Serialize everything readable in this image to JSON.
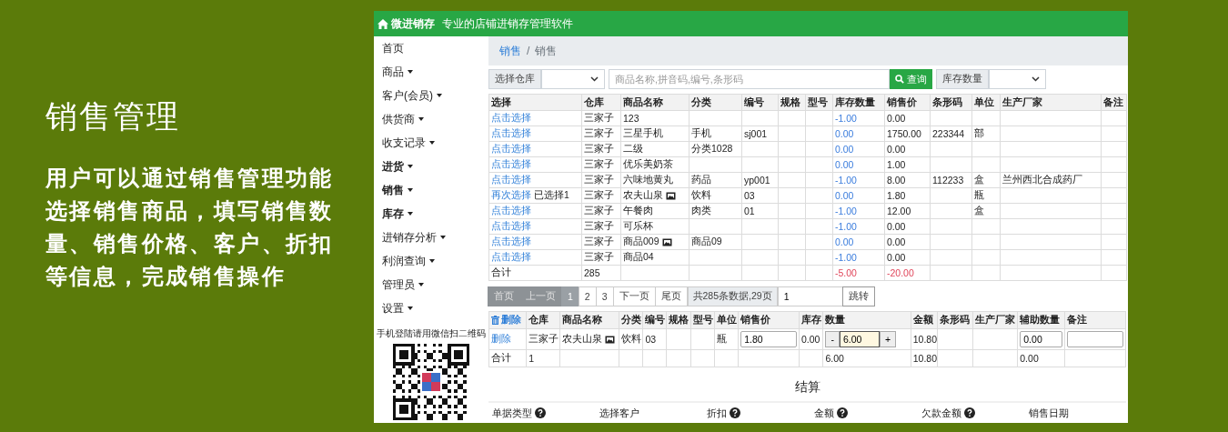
{
  "intro": {
    "title": "销售管理",
    "description": "用户可以通过销售管理功能选择销售商品，填写销售数量、销售价格、客户、折扣等信息，完成销售操作"
  },
  "header": {
    "brand": "微进销存",
    "tagline": "专业的店铺进销存管理软件"
  },
  "sidebar": {
    "items": [
      {
        "label": "首页",
        "dropdown": false,
        "bold": false
      },
      {
        "label": "商品",
        "dropdown": true,
        "bold": false
      },
      {
        "label": "客户(会员)",
        "dropdown": true,
        "bold": false
      },
      {
        "label": "供货商",
        "dropdown": true,
        "bold": false
      },
      {
        "label": "收支记录",
        "dropdown": true,
        "bold": false
      },
      {
        "label": "进货",
        "dropdown": true,
        "bold": true
      },
      {
        "label": "销售",
        "dropdown": true,
        "bold": true
      },
      {
        "label": "库存",
        "dropdown": true,
        "bold": true
      },
      {
        "label": "进销存分析",
        "dropdown": true,
        "bold": false
      },
      {
        "label": "利润查询",
        "dropdown": true,
        "bold": false
      },
      {
        "label": "管理员",
        "dropdown": true,
        "bold": false
      },
      {
        "label": "设置",
        "dropdown": true,
        "bold": false
      }
    ],
    "qr_caption": "手机登陆请用微信扫二维码"
  },
  "breadcrumb": {
    "items": [
      {
        "label": "销售",
        "link": true
      },
      {
        "label": "销售",
        "link": false
      }
    ],
    "separator": "/"
  },
  "search": {
    "warehouse_label": "选择仓库",
    "placeholder": "商品名称,拼音码,编号,条形码",
    "button": "查询",
    "stock_label": "库存数量"
  },
  "products": {
    "columns": [
      "选择",
      "仓库",
      "商品名称",
      "分类",
      "编号",
      "规格",
      "型号",
      "库存数量",
      "销售价",
      "条形码",
      "单位",
      "生产厂家",
      "备注"
    ],
    "rows": [
      {
        "kind": "item",
        "action": "点击选择",
        "warehouse": "三家子",
        "name": "123",
        "has_image": false,
        "category": "",
        "code": "",
        "stock": "-1.00",
        "price": "0.00",
        "barcode": "",
        "unit": "",
        "maker": ""
      },
      {
        "kind": "item",
        "action": "点击选择",
        "warehouse": "三家子",
        "name": "三星手机",
        "has_image": false,
        "category": "手机",
        "code": "sj001",
        "stock": "0.00",
        "price": "1750.00",
        "barcode": "223344",
        "unit": "部",
        "maker": ""
      },
      {
        "kind": "item",
        "action": "点击选择",
        "warehouse": "三家子",
        "name": "二级",
        "has_image": false,
        "category": "分类1028",
        "code": "",
        "stock": "0.00",
        "price": "0.00",
        "barcode": "",
        "unit": "",
        "maker": ""
      },
      {
        "kind": "item",
        "action": "点击选择",
        "warehouse": "三家子",
        "name": "优乐美奶茶",
        "has_image": false,
        "category": "",
        "code": "",
        "stock": "0.00",
        "price": "1.00",
        "barcode": "",
        "unit": "",
        "maker": ""
      },
      {
        "kind": "item",
        "action": "点击选择",
        "warehouse": "三家子",
        "name": "六味地黄丸",
        "has_image": false,
        "category": "药品",
        "code": "yp001",
        "stock": "-1.00",
        "price": "8.00",
        "barcode": "112233",
        "unit": "盒",
        "maker": "兰州西北合成药厂"
      },
      {
        "kind": "item",
        "action": "再次选择",
        "selected_note": "已选择1",
        "warehouse": "三家子",
        "name": "农夫山泉",
        "has_image": true,
        "category": "饮料",
        "code": "03",
        "stock": "0.00",
        "price": "1.80",
        "barcode": "",
        "unit": "瓶",
        "maker": ""
      },
      {
        "kind": "item",
        "action": "点击选择",
        "warehouse": "三家子",
        "name": "午餐肉",
        "has_image": false,
        "category": "肉类",
        "code": "01",
        "stock": "-1.00",
        "price": "12.00",
        "barcode": "",
        "unit": "盒",
        "maker": ""
      },
      {
        "kind": "item",
        "action": "点击选择",
        "warehouse": "三家子",
        "name": "可乐杯",
        "has_image": false,
        "category": "",
        "code": "",
        "stock": "-1.00",
        "price": "0.00",
        "barcode": "",
        "unit": "",
        "maker": ""
      },
      {
        "kind": "item",
        "action": "点击选择",
        "warehouse": "三家子",
        "name": "商品009",
        "has_image": true,
        "category": "商品09",
        "code": "",
        "stock": "0.00",
        "price": "0.00",
        "barcode": "",
        "unit": "",
        "maker": ""
      },
      {
        "kind": "item",
        "action": "点击选择",
        "warehouse": "三家子",
        "name": "商品04",
        "has_image": false,
        "category": "",
        "code": "",
        "stock": "-1.00",
        "price": "0.00",
        "barcode": "",
        "unit": "",
        "maker": ""
      },
      {
        "kind": "total",
        "label": "合计",
        "warehouse": "285",
        "stock": "-5.00",
        "price": "-20.00"
      }
    ]
  },
  "pagination": {
    "pages": [
      {
        "label": "首页",
        "kind": "disabled"
      },
      {
        "label": "上一页",
        "kind": "disabled"
      },
      {
        "label": "1",
        "kind": "current"
      },
      {
        "label": "2",
        "kind": "normal"
      },
      {
        "label": "3",
        "kind": "normal"
      },
      {
        "label": "下一页",
        "kind": "normal"
      },
      {
        "label": "尾页",
        "kind": "normal"
      }
    ],
    "summary": "共285条数据,29页",
    "page_value": "1",
    "jump": "跳转"
  },
  "cart": {
    "delete_header": "删除",
    "columns": [
      "仓库",
      "商品名称",
      "分类",
      "编号",
      "规格",
      "型号",
      "单位",
      "销售价",
      "库存",
      "数量",
      "金额",
      "条形码",
      "生产厂家",
      "辅助数量",
      "备注"
    ],
    "rows": [
      {
        "action": "删除",
        "warehouse": "三家子",
        "name": "农夫山泉",
        "has_image": true,
        "category": "饮料",
        "code": "03",
        "unit": "瓶",
        "price": "1.80",
        "stock": "0.00",
        "minus": "-",
        "quantity": "6.00",
        "quantity_focused": true,
        "plus": "+",
        "amount": "10.80",
        "aux": "0.00"
      }
    ],
    "total": {
      "label": "合计",
      "count": "1",
      "quantity": "6.00",
      "amount": "10.80",
      "aux": "0.00"
    }
  },
  "settlement": {
    "title": "结算",
    "fields": [
      {
        "label": "单据类型",
        "help": true
      },
      {
        "label": "选择客户",
        "help": false
      },
      {
        "label": "折扣",
        "help": true
      },
      {
        "label": "金额",
        "help": true
      },
      {
        "label": "欠款金额",
        "help": true
      },
      {
        "label": "销售日期",
        "help": false
      }
    ]
  }
}
